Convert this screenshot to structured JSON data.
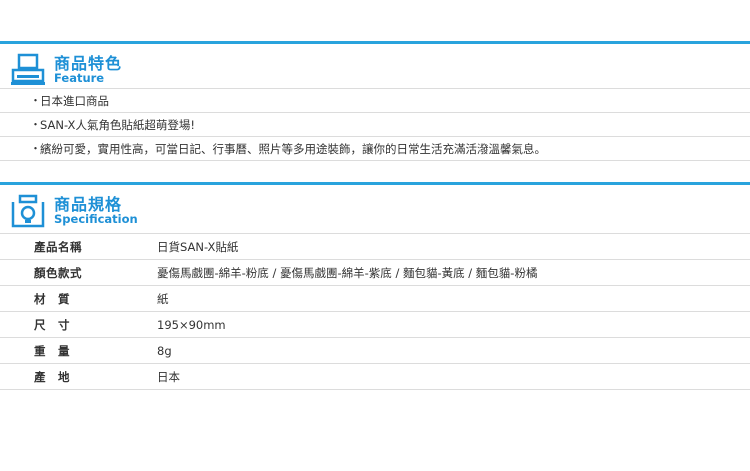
{
  "feature": {
    "title": "商品特色",
    "subtitle": "Feature",
    "icon": "printer-icon",
    "accent_color": "#29a3dd",
    "items": [
      "日本進口商品",
      "SAN-X人氣角色貼紙超萌登場!",
      "繽紛可愛，實用性高，可當日記、行事曆、照片等多用途裝飾，讓你的日常生活充滿活潑溫馨氣息。"
    ],
    "bullet": "・"
  },
  "specification": {
    "title": "商品規格",
    "subtitle": "Specification",
    "icon": "camera-icon",
    "rows": [
      {
        "label": "產品名稱",
        "value": "日貨SAN-X貼紙"
      },
      {
        "label": "顏色款式",
        "value": "憂傷馬戲團-綿羊-粉底 / 憂傷馬戲團-綿羊-紫底 / 麵包貓-黃底 / 麵包貓-粉橘"
      },
      {
        "label": "材　質",
        "value": "紙"
      },
      {
        "label": "尺　寸",
        "value": "195×90mm"
      },
      {
        "label": "重　量",
        "value": "8g"
      },
      {
        "label": "產　地",
        "value": "日本"
      }
    ]
  }
}
